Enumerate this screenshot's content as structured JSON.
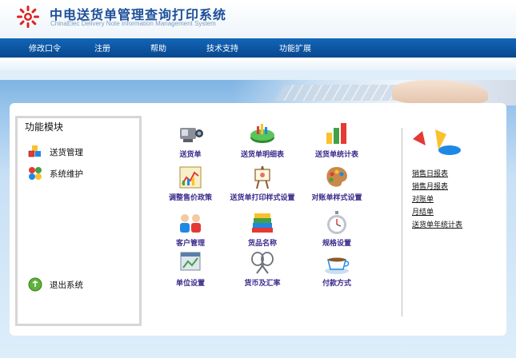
{
  "header": {
    "title": "中电送货单管理查询打印系统",
    "subtitle": "ChinaElec Delivery Note Information Management System"
  },
  "nav": {
    "items": [
      "修改口令",
      "注册",
      "帮助",
      "技术支持",
      "功能扩展"
    ]
  },
  "sidebar": {
    "title": "功能模块",
    "items": [
      {
        "label": "送货管理",
        "icon": "cubes-icon"
      },
      {
        "label": "系统维护",
        "icon": "puzzle-icon"
      }
    ],
    "logout_label": "退出系统"
  },
  "grid": {
    "items": [
      {
        "label": "送货单",
        "icon": "camcorder-icon"
      },
      {
        "label": "送货单明细表",
        "icon": "pie-disk-icon"
      },
      {
        "label": "送货单统计表",
        "icon": "bar-chart-icon"
      },
      {
        "label": "调整售价政策",
        "icon": "line-chart-icon"
      },
      {
        "label": "送货单打印样式设置",
        "icon": "easel-icon"
      },
      {
        "label": "对账单样式设置",
        "icon": "palette-icon"
      },
      {
        "label": "客户管理",
        "icon": "users-icon"
      },
      {
        "label": "货品名称",
        "icon": "books-icon"
      },
      {
        "label": "规格设置",
        "icon": "stopwatch-icon"
      },
      {
        "label": "单位设置",
        "icon": "window-icon"
      },
      {
        "label": "货币及汇率",
        "icon": "rackets-icon"
      },
      {
        "label": "付款方式",
        "icon": "teacup-icon"
      }
    ]
  },
  "reports": {
    "items": [
      "销售日报表",
      "销售月报表",
      "对账单",
      "月结单",
      "送货单年统计表"
    ]
  },
  "colors": {
    "nav_bg": "#0b52a0",
    "title": "#1d4f99",
    "grid_caption": "#3b2a8b"
  }
}
